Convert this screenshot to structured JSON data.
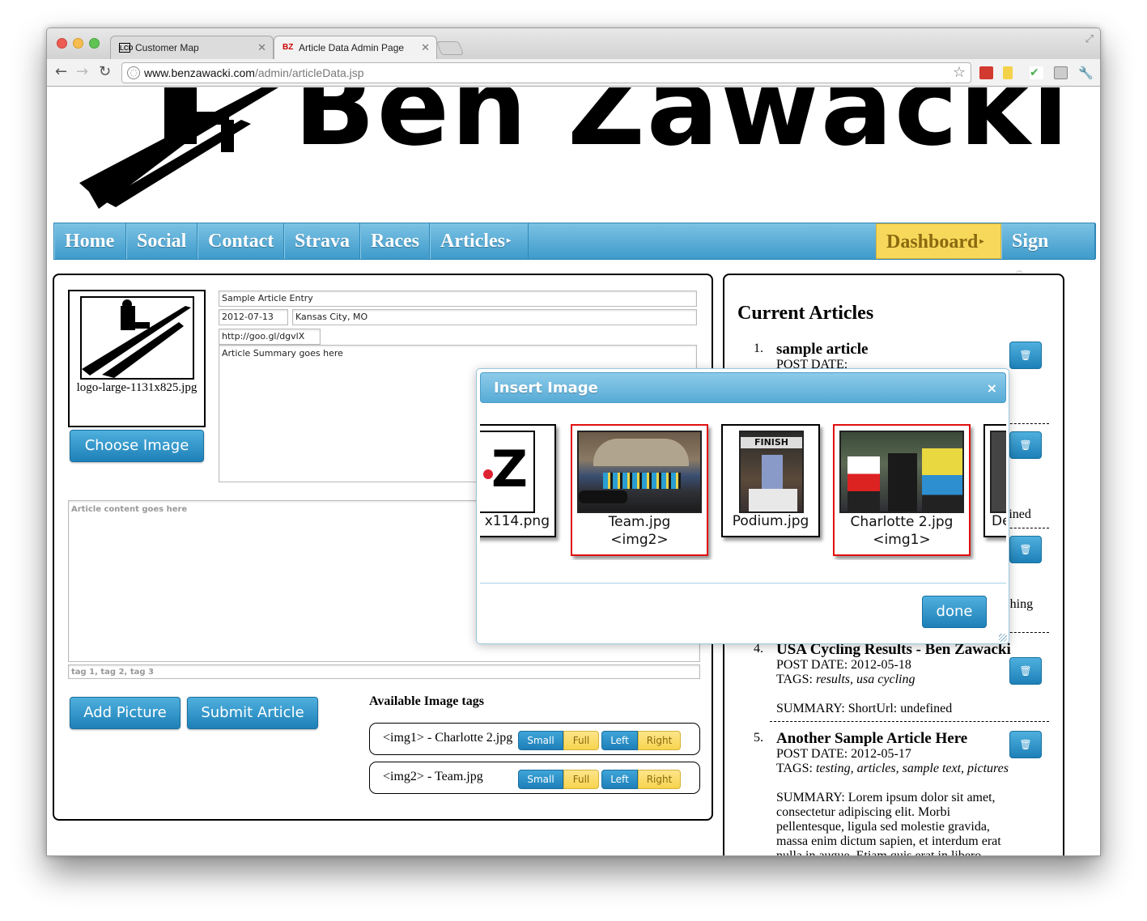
{
  "browser": {
    "tabs": [
      {
        "label": "Customer Map",
        "favicon": "LCD"
      },
      {
        "label": "Article Data Admin Page",
        "favicon": "BZ"
      }
    ],
    "url_host": "www.benzawacki.com",
    "url_path": "/admin/articleData.jsp"
  },
  "site": {
    "banner_title": "Ben Zawacki",
    "nav": [
      "Home",
      "Social",
      "Contact",
      "Strava",
      "Races",
      "Articles"
    ],
    "dashboard_label": "Dashboard",
    "signout_label": "Sign Out",
    "accent_blue": "#3e9bcb",
    "accent_yellow": "#f7d85a"
  },
  "editor": {
    "image_caption": "logo-large-1131x825.jpg",
    "choose_image_label": "Choose Image",
    "title_value": "Sample Article Entry",
    "date_value": "2012-07-13",
    "location_value": "Kansas City, MO",
    "shorturl_value": "http://goo.gl/dgvlX",
    "summary_value": "Article Summary goes here",
    "content_placeholder": "Article content goes here",
    "tags_placeholder": "tag 1, tag 2, tag 3",
    "add_picture_label": "Add Picture",
    "submit_label": "Submit Article",
    "image_tags_heading": "Available Image tags",
    "image_tags": [
      {
        "label": "<img1> - Charlotte 2.jpg"
      },
      {
        "label": "<img2> - Team.jpg"
      }
    ],
    "size_options": [
      "Small",
      "Full"
    ],
    "align_options": [
      "Left",
      "Right"
    ]
  },
  "articles": {
    "heading": "Current Articles",
    "items": [
      {
        "num": "1.",
        "title": "sample article",
        "post_date": "POST DATE:"
      },
      {
        "partial_text": "fined"
      },
      {
        "partial_text": "nishing"
      },
      {
        "num": "4.",
        "title": "USA Cycling Results - Ben Zawacki",
        "post_date": "POST DATE: 2012-05-18",
        "tags_label": "TAGS:",
        "tags": "results, usa cycling",
        "summary": "SUMMARY: ShortUrl: undefined"
      },
      {
        "num": "5.",
        "title": "Another Sample Article Here",
        "post_date": "POST DATE: 2012-05-17",
        "tags_label": "TAGS:",
        "tags": "testing, articles, sample text, pictures",
        "summary": "SUMMARY: Lorem ipsum dolor sit amet, consectetur adipiscing elit. Morbi pellentesque, ligula sed molestie gravida, massa enim dictum sapien, et interdum erat nulla in augue. Etiam quis erat in libero pretium rShortUrl: undefined"
      }
    ]
  },
  "modal": {
    "title": "Insert Image",
    "close_glyph": "×",
    "cards": [
      {
        "caption": "x114.png",
        "tag": ""
      },
      {
        "caption": "Team.jpg",
        "tag": "<img2>"
      },
      {
        "caption": "Podium.jpg",
        "tag": ""
      },
      {
        "caption": "Charlotte 2.jpg",
        "tag": "<img1>"
      },
      {
        "caption": "De",
        "tag": ""
      }
    ],
    "done_label": "done"
  }
}
